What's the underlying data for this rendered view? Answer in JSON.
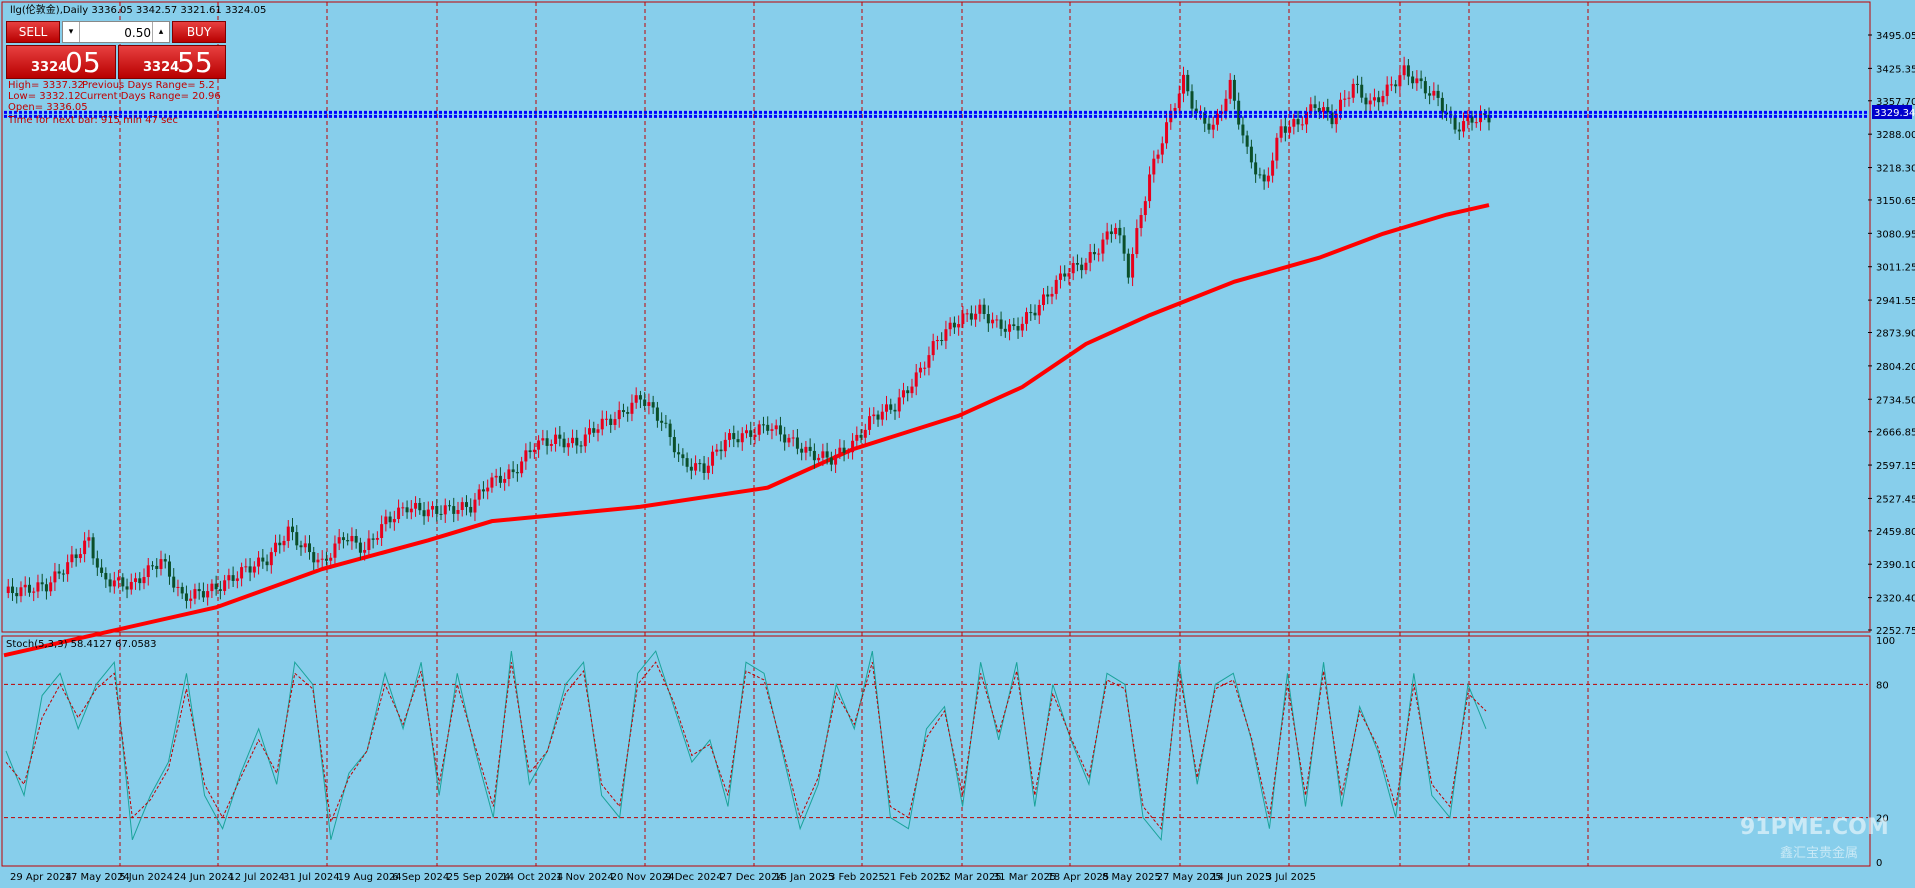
{
  "header": {
    "symbol_line": "llg(伦敦金),Daily  3336.05 3342.57 3321.61 3324.05"
  },
  "trade_panel": {
    "sell_label": "SELL",
    "buy_label": "BUY",
    "lot": "0.50",
    "bid_small": "3324",
    "bid_big": "05",
    "ask_small": "3324",
    "ask_big": "55",
    "down_arrow": "▾",
    "up_arrow": "▴"
  },
  "info_lines": {
    "high": "High= 3337.32",
    "prev_range": "Previous Days Range= 5.2",
    "low": "Low= 3332.12",
    "curr_range": "Current Days Range= 20.96",
    "open": "Open= 3336.05",
    "timer": "Time for next bar: 915 min 47 sec"
  },
  "price_label": "3329.34",
  "stoch_label": "Stoch(5,3,3) 58.4127 67.0583",
  "watermark": {
    "main": "91PME.COM",
    "sub": "鑫汇宝贵金属"
  },
  "colors": {
    "background": "#87ceeb",
    "bull": "#e8001c",
    "bear": "#0b4f2a",
    "ma": "#ff0000",
    "stoch_main": "#1aa39a",
    "stoch_signal": "#c00000",
    "grid": "#c00000",
    "price_line": "#0000ff"
  },
  "chart_data": {
    "type": "line",
    "y_ticks": [
      "3495.05",
      "3425.35",
      "3357.70",
      "3288.00",
      "3218.30",
      "3150.65",
      "3080.95",
      "3011.25",
      "2941.55",
      "2873.90",
      "2804.20",
      "2734.50",
      "2666.85",
      "2597.15",
      "2527.45",
      "2459.80",
      "2390.10",
      "2320.40",
      "2252.75"
    ],
    "ylim": [
      2252.75,
      3495.05
    ],
    "x_ticks": [
      "29 Apr 2024",
      "17 May 2024",
      "5 Jun 2024",
      "24 Jun 2024",
      "12 Jul 2024",
      "31 Jul 2024",
      "19 Aug 2024",
      "6 Sep 2024",
      "25 Sep 2024",
      "14 Oct 2024",
      "1 Nov 2024",
      "20 Nov 2024",
      "9 Dec 2024",
      "27 Dec 2024",
      "15 Jan 2025",
      "3 Feb 2025",
      "21 Feb 2025",
      "12 Mar 2025",
      "31 Mar 2025",
      "18 Apr 2025",
      "8 May 2025",
      "27 May 2025",
      "14 Jun 2025",
      "3 Jul 2025"
    ],
    "close_series": {
      "name": "",
      "points": [
        [
          0,
          2330
        ],
        [
          10,
          2345
        ],
        [
          15,
          2390
        ],
        [
          20,
          2440
        ],
        [
          23,
          2360
        ],
        [
          30,
          2345
        ],
        [
          37,
          2400
        ],
        [
          42,
          2320
        ],
        [
          50,
          2340
        ],
        [
          57,
          2380
        ],
        [
          62,
          2400
        ],
        [
          67,
          2460
        ],
        [
          70,
          2430
        ],
        [
          75,
          2390
        ],
        [
          80,
          2450
        ],
        [
          85,
          2420
        ],
        [
          90,
          2480
        ],
        [
          95,
          2510
        ],
        [
          100,
          2500
        ],
        [
          110,
          2510
        ],
        [
          114,
          2560
        ],
        [
          120,
          2580
        ],
        [
          125,
          2640
        ],
        [
          130,
          2650
        ],
        [
          135,
          2640
        ],
        [
          140,
          2680
        ],
        [
          145,
          2700
        ],
        [
          150,
          2740
        ],
        [
          155,
          2690
        ],
        [
          160,
          2600
        ],
        [
          165,
          2590
        ],
        [
          170,
          2650
        ],
        [
          175,
          2660
        ],
        [
          180,
          2680
        ],
        [
          185,
          2650
        ],
        [
          190,
          2620
        ],
        [
          195,
          2610
        ],
        [
          200,
          2640
        ],
        [
          205,
          2700
        ],
        [
          210,
          2720
        ],
        [
          215,
          2780
        ],
        [
          220,
          2860
        ],
        [
          225,
          2900
        ],
        [
          230,
          2920
        ],
        [
          234,
          2890
        ],
        [
          238,
          2880
        ],
        [
          244,
          2930
        ],
        [
          250,
          3000
        ],
        [
          255,
          3020
        ],
        [
          258,
          3050
        ],
        [
          262,
          3100
        ],
        [
          265,
          3000
        ],
        [
          270,
          3200
        ],
        [
          275,
          3330
        ],
        [
          278,
          3400
        ],
        [
          281,
          3330
        ],
        [
          285,
          3300
        ],
        [
          289,
          3390
        ],
        [
          293,
          3250
        ],
        [
          297,
          3180
        ],
        [
          301,
          3300
        ],
        [
          305,
          3310
        ],
        [
          309,
          3350
        ],
        [
          313,
          3320
        ],
        [
          318,
          3390
        ],
        [
          322,
          3350
        ],
        [
          326,
          3380
        ],
        [
          330,
          3420
        ],
        [
          334,
          3390
        ],
        [
          338,
          3360
        ],
        [
          342,
          3300
        ],
        [
          346,
          3320
        ],
        [
          350,
          3324
        ]
      ]
    },
    "ma_series": {
      "name": "",
      "points": [
        [
          0,
          2200
        ],
        [
          50,
          2300
        ],
        [
          75,
          2380
        ],
        [
          100,
          2440
        ],
        [
          115,
          2480
        ],
        [
          150,
          2510
        ],
        [
          180,
          2550
        ],
        [
          200,
          2630
        ],
        [
          225,
          2700
        ],
        [
          240,
          2760
        ],
        [
          255,
          2850
        ],
        [
          270,
          2910
        ],
        [
          290,
          2980
        ],
        [
          310,
          3030
        ],
        [
          325,
          3080
        ],
        [
          340,
          3120
        ],
        [
          350,
          3140
        ]
      ]
    },
    "stochastic": {
      "levels": [
        20,
        80
      ],
      "ylim": [
        0,
        100
      ],
      "y_ticks": [
        "100",
        "80",
        "20",
        "0"
      ],
      "main": [
        50,
        30,
        75,
        85,
        60,
        80,
        90,
        10,
        30,
        45,
        85,
        30,
        15,
        40,
        60,
        35,
        90,
        80,
        10,
        40,
        50,
        85,
        60,
        90,
        30,
        85,
        50,
        20,
        95,
        35,
        50,
        80,
        90,
        30,
        20,
        85,
        95,
        70,
        45,
        55,
        25,
        90,
        85,
        50,
        15,
        35,
        80,
        60,
        95,
        20,
        15,
        60,
        70,
        25,
        90,
        55,
        90,
        25,
        80,
        55,
        35,
        85,
        80,
        20,
        10,
        90,
        35,
        80,
        85,
        55,
        15,
        85,
        25,
        90,
        25,
        70,
        50,
        20,
        85,
        30,
        20,
        80,
        60
      ],
      "signal": [
        45,
        35,
        65,
        80,
        65,
        78,
        85,
        20,
        28,
        42,
        78,
        35,
        20,
        38,
        55,
        40,
        85,
        78,
        18,
        38,
        50,
        80,
        62,
        86,
        35,
        80,
        52,
        25,
        90,
        40,
        50,
        76,
        86,
        35,
        25,
        80,
        90,
        72,
        48,
        53,
        30,
        86,
        82,
        52,
        20,
        38,
        76,
        62,
        90,
        25,
        20,
        56,
        68,
        30,
        85,
        58,
        86,
        30,
        76,
        56,
        38,
        82,
        78,
        25,
        15,
        86,
        38,
        78,
        82,
        56,
        20,
        80,
        30,
        86,
        30,
        68,
        52,
        25,
        80,
        35,
        25,
        76,
        68
      ]
    }
  }
}
